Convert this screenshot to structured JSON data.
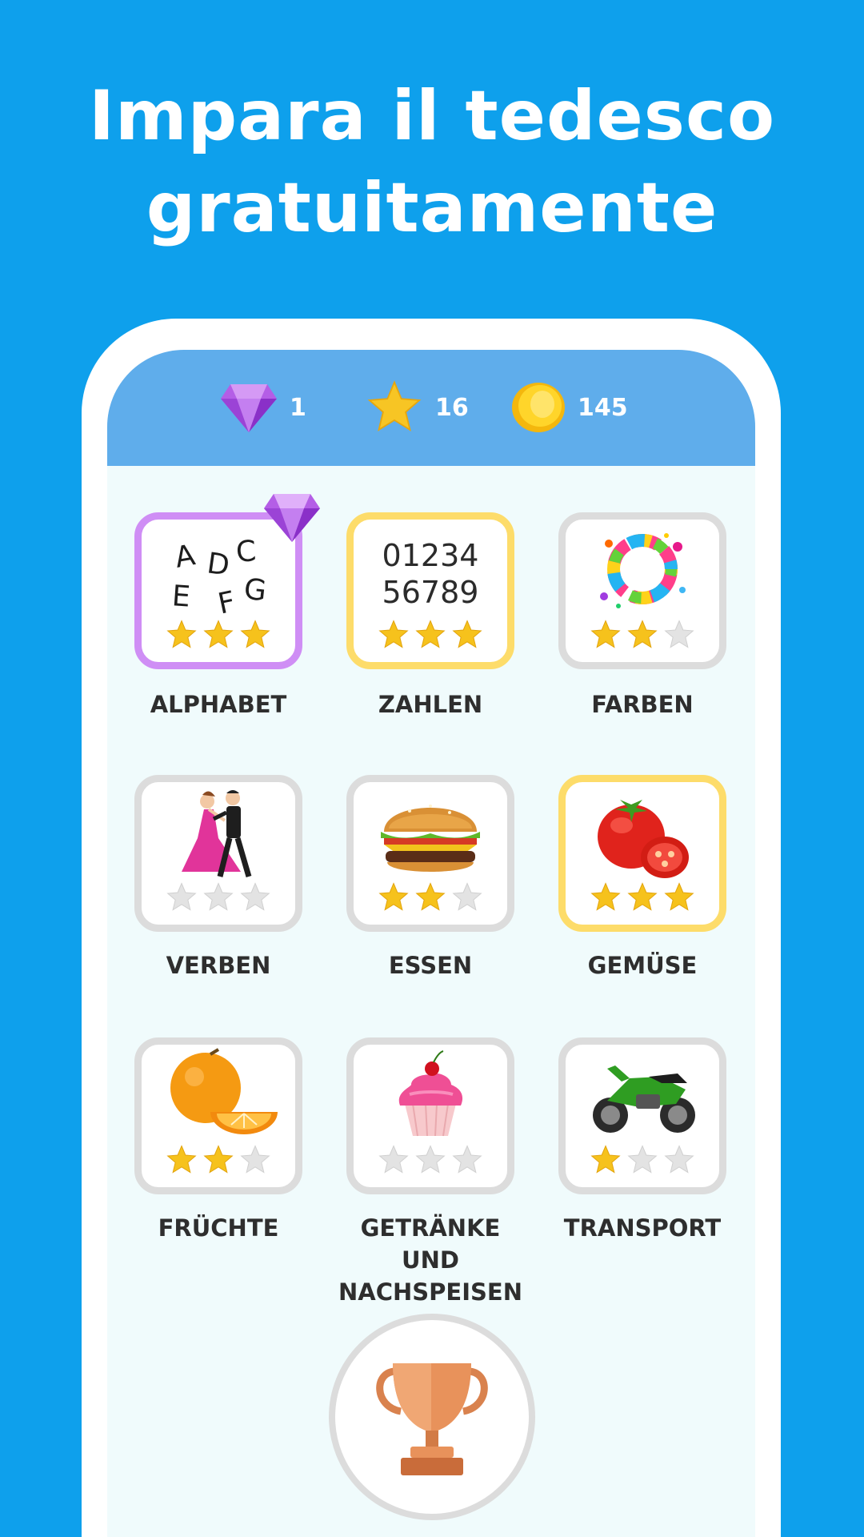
{
  "headline": {
    "line1": "Impara il tedesco",
    "line2": "gratuitamente"
  },
  "stats": {
    "gems": "1",
    "stars": "16",
    "coins": "145"
  },
  "colors": {
    "background": "#0ea0ec",
    "topbar": "#5fadeb",
    "screen": "#f0fbfc",
    "tile_border_default": "#dcdcdc",
    "tile_border_gem": "#cf8ef5",
    "tile_border_gold": "#fddc6a",
    "star_filled": "#f6c21c",
    "star_empty": "#dedede"
  },
  "categories": [
    {
      "label": "ALPHABET",
      "icon": "alphabet-letters-icon",
      "stars": 3,
      "highlight": "purple",
      "gem_badge": true
    },
    {
      "label": "ZAHLEN",
      "icon": "numbers-icon",
      "stars": 3,
      "highlight": "gold",
      "numbers_line1": "01234",
      "numbers_line2": "56789"
    },
    {
      "label": "FARBEN",
      "icon": "color-splash-icon",
      "stars": 2,
      "highlight": "none"
    },
    {
      "label": "VERBEN",
      "icon": "dancing-couple-icon",
      "stars": 0,
      "highlight": "none"
    },
    {
      "label": "ESSEN",
      "icon": "burger-icon",
      "stars": 2,
      "highlight": "none"
    },
    {
      "label": "GEMÜSE",
      "icon": "tomato-icon",
      "stars": 3,
      "highlight": "gold"
    },
    {
      "label": "FRÜCHTE",
      "icon": "orange-icon",
      "stars": 2,
      "highlight": "none"
    },
    {
      "label": "GETRÄNKE UND NACHSPEISEN",
      "icon": "cupcake-icon",
      "stars": 0,
      "highlight": "none"
    },
    {
      "label": "TRANSPORT",
      "icon": "motorcycle-icon",
      "stars": 1,
      "highlight": "none"
    }
  ],
  "alphabet_letters": [
    "A",
    "D",
    "C",
    "E",
    "F",
    "G"
  ],
  "trophy": {
    "icon": "trophy-icon"
  }
}
